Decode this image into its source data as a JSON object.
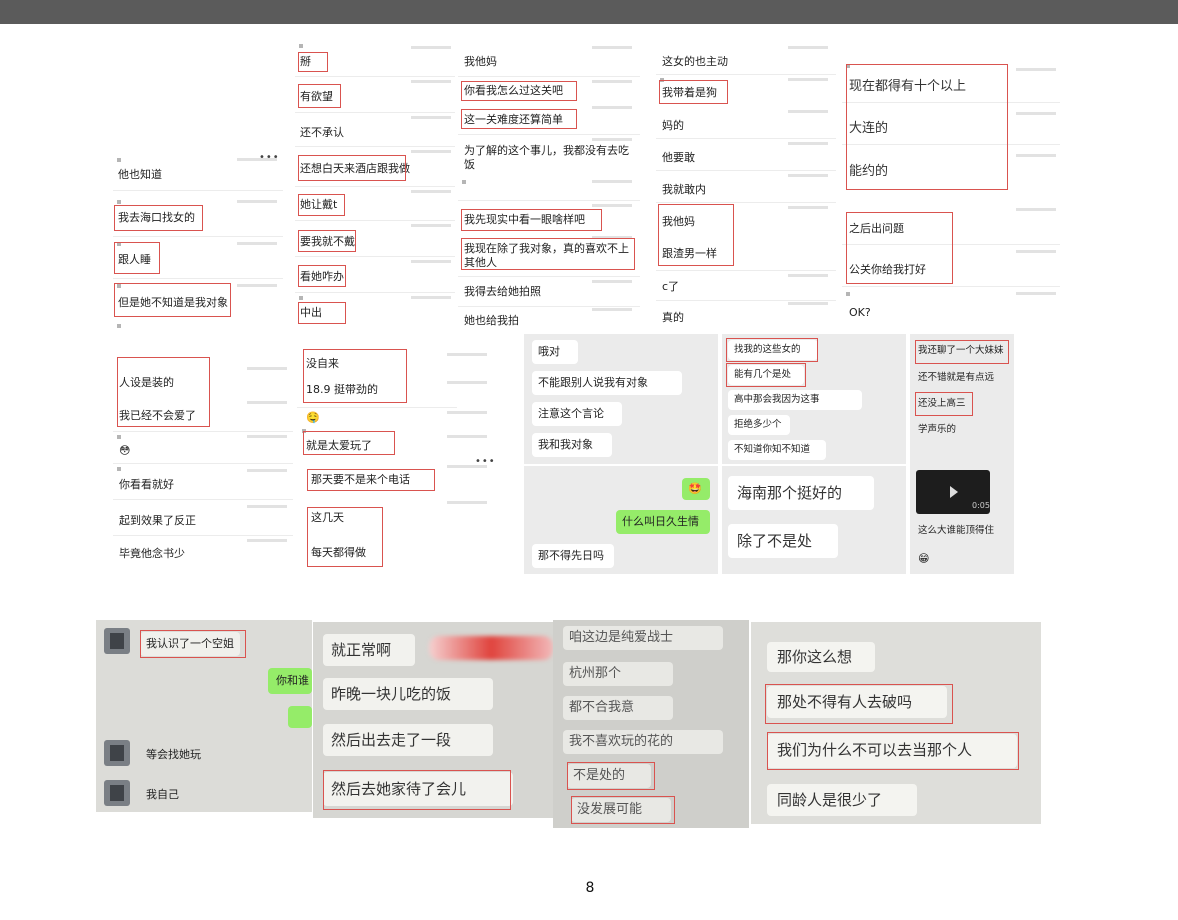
{
  "page": {
    "number": "8"
  },
  "panels": {
    "p1": {
      "more": "•••",
      "lines": [
        "他也知道",
        "我去海口找女的",
        "跟人睡",
        "但是她不知道是我对象"
      ]
    },
    "p2": {
      "lines": [
        "掰",
        "有欲望",
        "还不承认",
        "还想白天来酒店跟我做",
        "她让戴t",
        "要我就不戴",
        "看她咋办",
        "中出"
      ]
    },
    "p3": {
      "lines": [
        "我他妈",
        "你看我怎么过这关吧",
        "这一关难度还算简单",
        "为了解的这个事儿，我都没有去吃饭",
        "我先现实中看一眼啥样吧",
        "我现在除了我对象，真的喜欢不上其他人",
        "我得去给她拍照",
        "她也给我拍"
      ]
    },
    "p4": {
      "lines": [
        "这女的也主动",
        "我带着是狗",
        "妈的",
        "他要敢",
        "我就敢内",
        "我他妈",
        "跟渣男一样",
        "c了",
        "真的"
      ]
    },
    "p5": {
      "lines": [
        "现在都得有十个以上",
        "大连的",
        "能约的",
        "之后出问题",
        "公关你给我打好",
        "OK?"
      ]
    },
    "p6": {
      "lines": [
        "人设是装的",
        "我已经不会爱了",
        "😳",
        "你看看就好",
        "起到效果了反正",
        "毕竟他念书少"
      ]
    },
    "p7": {
      "more": "•••",
      "lines": [
        "没自来",
        "18.9 挺带劲的",
        "🤤",
        "就是太爱玩了",
        "那天要不是来个电话",
        "这几天",
        "每天都得做"
      ]
    },
    "p8": {
      "lines": [
        "哦对",
        "不能跟别人说我有对象",
        "注意这个言论",
        "我和我对象"
      ]
    },
    "p9": {
      "emoji": "🤩",
      "lines": [
        "什么叫日久生情",
        "那不得先日吗"
      ]
    },
    "p10": {
      "lines": [
        "找我的这些女的",
        "能有几个是处",
        "高中那会我因为这事",
        "拒绝多少个",
        "不知道你知不知道"
      ]
    },
    "p11": {
      "lines": [
        "海南那个挺好的",
        "除了不是处"
      ]
    },
    "p12": {
      "video_time": "0:05",
      "lines": [
        "我还聊了一个大妹妹",
        "还不错就是有点远",
        "还没上高三",
        "学声乐的",
        "这么大谁能顶得住",
        "😁"
      ]
    },
    "p13": {
      "lines": [
        "我认识了一个空姐",
        "你和谁",
        "等会找她玩",
        "我自己"
      ]
    },
    "p14": {
      "lines": [
        "就正常啊",
        "昨晚一块儿吃的饭",
        "然后出去走了一段",
        "然后去她家待了会儿"
      ]
    },
    "p15": {
      "lines": [
        "咱这边是纯爱战士",
        "杭州那个",
        "都不合我意",
        "我不喜欢玩的花的",
        "不是处的",
        "没发展可能"
      ]
    },
    "p16": {
      "lines": [
        "那你这么想",
        "那处不得有人去破吗",
        "我们为什么不可以去当那个人",
        "同龄人是很少了"
      ]
    }
  },
  "colors": {
    "highlight_box": "#d9534f",
    "wechat_green": "#95ec69",
    "top_bar": "#5b5b5b"
  }
}
